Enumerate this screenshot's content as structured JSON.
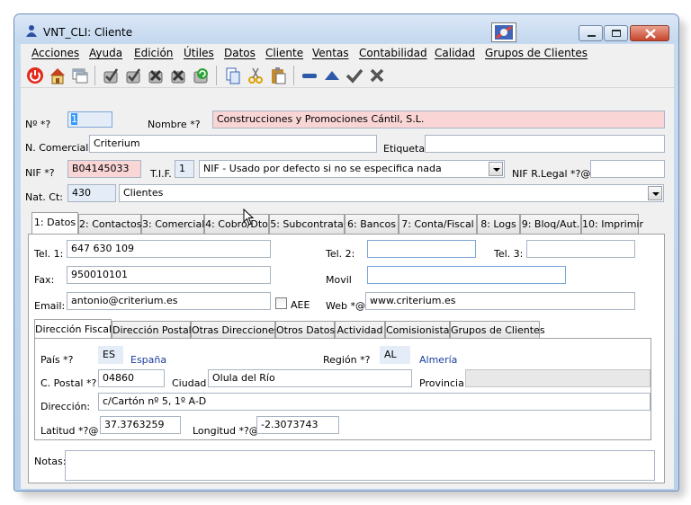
{
  "window": {
    "title": "VNT_CLI: Cliente"
  },
  "menu": [
    "Acciones",
    "Ayuda",
    "Edición",
    "Útiles",
    "Datos",
    "Cliente",
    "Ventas",
    "Contabilidad",
    "Calidad",
    "Grupos de Clientes"
  ],
  "toolbar": {
    "icons": [
      "power-icon",
      "home-icon",
      "windows-icon",
      "check-wrench-icon",
      "check-icon",
      "remove-icon",
      "tools-icon",
      "refresh-icon",
      "copy-icon",
      "cut-icon",
      "paste-icon",
      "minus-icon",
      "triangle-up-icon",
      "checkmark-icon",
      "x-icon"
    ]
  },
  "form": {
    "num_label": "Nº *?",
    "num_value": "1",
    "nombre_label": "Nombre *?",
    "nombre_value": "Construcciones y Promociones Cántil, S.L.",
    "ncomercial_label": "N. Comercial:",
    "ncomercial_value": "Criterium",
    "etiquetas_label": "Etiquetas",
    "etiquetas_value": "",
    "nif_label": "NIF *?",
    "nif_value": "B04145033",
    "tif_label": "T.I.F.",
    "tif_value": "1",
    "tif_desc": "NIF - Usado por defecto si no se especifica nada",
    "nif_legal_label": "NIF R.Legal *?@",
    "nif_legal_value": "",
    "natct_label": "Nat. Ct:",
    "natct_code": "430",
    "natct_value": "Clientes"
  },
  "tabs": [
    "1: Datos",
    "2: Contactos",
    "3: Comercial",
    "4: Cobro/Dto",
    "5: Subcontrata",
    "6: Bancos",
    "7: Conta/Fiscal",
    "8: Logs",
    "9: Bloq/Aut.",
    "10: Imprimir"
  ],
  "datos": {
    "tel1_label": "Tel. 1:",
    "tel1_value": "647 630 109",
    "tel2_label": "Tel. 2:",
    "tel2_value": "",
    "tel3_label": "Tel. 3:",
    "tel3_value": "",
    "fax_label": "Fax:",
    "fax_value": "950010101",
    "movil_label": "Movil",
    "movil_value": "",
    "email_label": "Email:",
    "email_value": "antonio@criterium.es",
    "aee_label": "AEE",
    "web_label": "Web *@",
    "web_value": "www.criterium.es",
    "notas_label": "Notas:",
    "notas_value": ""
  },
  "subtabs": [
    "Dirección Fiscal",
    "Dirección Postal",
    "Otras Direcciones",
    "Otros Datos",
    "Actividad",
    "Comisionista",
    "Grupos de Clientes"
  ],
  "direccion": {
    "pais_label": "País *?",
    "pais_code": "ES",
    "pais_name": "España",
    "region_label": "Región *?",
    "region_code": "AL",
    "region_name": "Almería",
    "cpostal_label": "C. Postal *?",
    "cpostal_value": "04860",
    "ciudad_label": "Ciudad",
    "ciudad_value": "Olula del Río",
    "provincia_label": "Provincia:",
    "provincia_value": "",
    "direccion_label": "Dirección:",
    "direccion_value": "c/Cartón nº 5, 1º A-D",
    "latitud_label": "Latitud *?@",
    "latitud_value": "37.3763259",
    "longitud_label": "Longitud *?@",
    "longitud_value": "-2.3073743"
  }
}
